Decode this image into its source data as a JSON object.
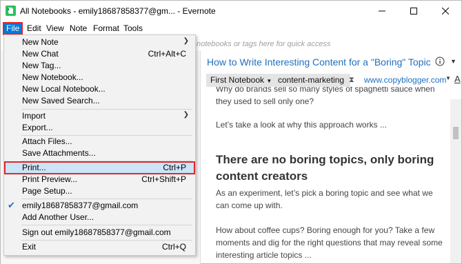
{
  "window": {
    "title": "All Notebooks - emily18687858377@gm... - Evernote"
  },
  "menubar": {
    "items": [
      "File",
      "Edit",
      "View",
      "Note",
      "Format",
      "Tools"
    ]
  },
  "search": {
    "placeholder": "notebooks or tags here for quick access"
  },
  "note": {
    "title": "How to Write Interesting Content for a \"Boring\" Topic -",
    "notebook": "First Notebook",
    "tag": "content-marketing",
    "url": "www.copyblogger.com",
    "font_icon_glyph": "A",
    "body": {
      "p1": "Why do brands sell so many styles of spaghetti sauce when they used to sell only one?",
      "p2": "Let’s take a look at why this approach works ...",
      "heading": "There are no boring topics, only boring content creators",
      "p3": "As an experiment, let’s pick a boring topic and see what we can come up with.",
      "p4": "How about coffee cups? Boring enough for you? Take a few moments and dig for the right questions that may reveal some interesting article topics ..."
    }
  },
  "file_menu": {
    "new_note": "New Note",
    "new_chat": "New Chat",
    "new_chat_sc": "Ctrl+Alt+C",
    "new_tag": "New Tag...",
    "new_notebook": "New Notebook...",
    "new_local_notebook": "New Local Notebook...",
    "new_saved_search": "New Saved Search...",
    "import": "Import",
    "export": "Export...",
    "attach_files": "Attach Files...",
    "save_attachments": "Save Attachments...",
    "print": "Print...",
    "print_sc": "Ctrl+P",
    "print_preview": "Print Preview...",
    "print_preview_sc": "Ctrl+Shift+P",
    "page_setup": "Page Setup...",
    "account": "emily18687858377@gmail.com",
    "add_user": "Add Another User...",
    "sign_out": "Sign out emily18687858377@gmail.com",
    "exit": "Exit",
    "exit_sc": "Ctrl+Q"
  },
  "colors": {
    "accent": "#0078d7",
    "highlight_outline": "#e0262a",
    "link": "#1f6fc1",
    "evernote_green": "#2dbe60"
  }
}
